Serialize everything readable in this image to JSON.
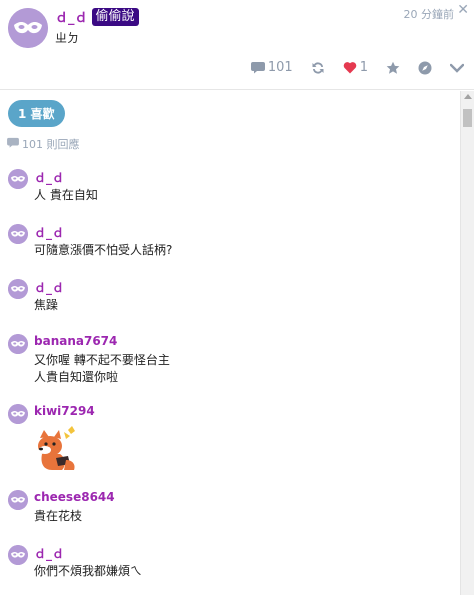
{
  "post": {
    "author": "ｄ_ｄ",
    "badge": "偷偷說",
    "subtitle": "ㄓㄉ",
    "time": "20 分鐘前",
    "close": "✕",
    "comment_count": "101",
    "like_count": "1"
  },
  "likes": {
    "label": "1 喜歡"
  },
  "replies": {
    "label": "101 則回應"
  },
  "comments": [
    {
      "name": "ｄ_ｄ",
      "lines": [
        "人 貴在自知"
      ]
    },
    {
      "name": "ｄ_ｄ",
      "lines": [
        "可隨意漲價不怕受人話柄?"
      ]
    },
    {
      "name": "ｄ_ｄ",
      "lines": [
        "焦躁"
      ]
    },
    {
      "name": "banana7674",
      "lines": [
        "又你喔 轉不起不要怪台主",
        "人貴自知還你啦"
      ]
    },
    {
      "name": "kiwi7294",
      "lines": []
    },
    {
      "name": "cheese8644",
      "lines": [
        "貴在花枝"
      ]
    },
    {
      "name": "ｄ_ｄ",
      "lines": [
        "你們不煩我都嫌煩ㄟ"
      ]
    }
  ],
  "icons": {
    "avatar": "mask-icon",
    "comment": "comment-icon",
    "repost": "refresh-icon",
    "like": "heart-icon",
    "favorite": "star-icon",
    "share": "compass-icon",
    "more": "chevron-down-icon",
    "sticker": "fox-sticker"
  },
  "colors": {
    "accent": "#9c27b0",
    "badge_bg": "#3b0a84",
    "like_pill": "#5aa5c9",
    "heart": "#e53950",
    "muted": "#8e9aab"
  }
}
